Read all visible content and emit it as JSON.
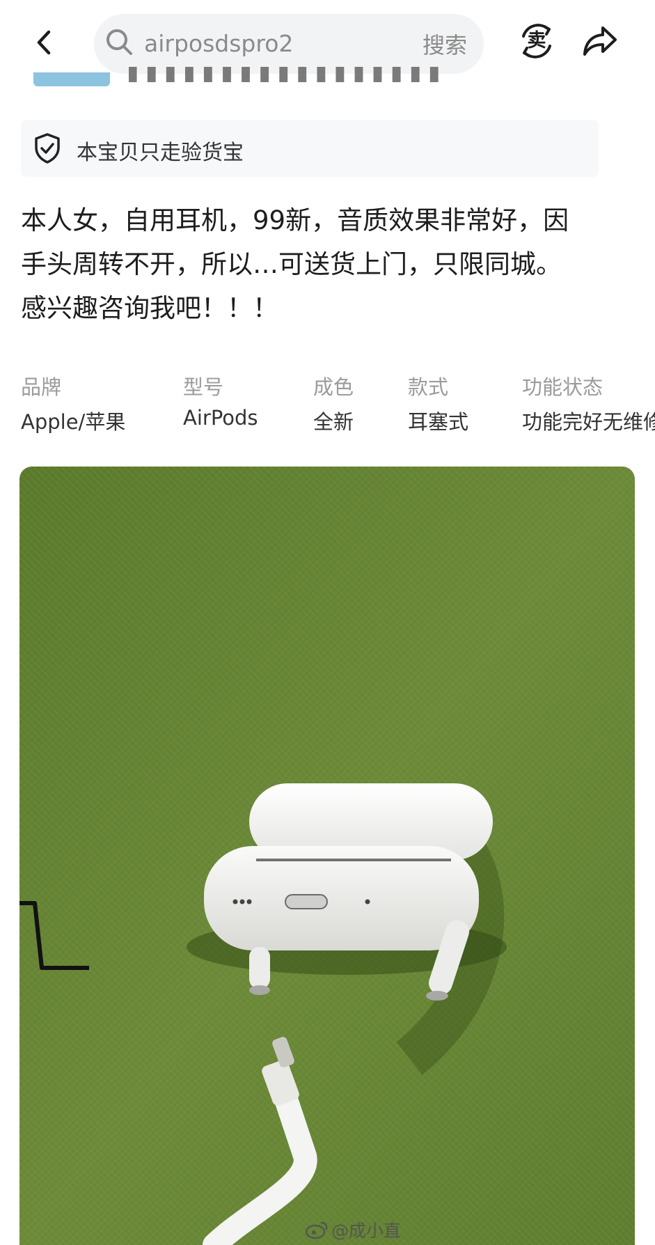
{
  "header": {
    "search": {
      "value": "airposdspro2",
      "button_label": "搜索"
    },
    "sell_label": "卖"
  },
  "guarantee": {
    "text": "本宝贝只走验货宝"
  },
  "description": {
    "lines": [
      "本人女，自用耳机，99新，音质效果非常好，因",
      "手头周转不开，所以…可送货上门，只限同城。",
      "感兴趣咨询我吧！！！"
    ]
  },
  "specs": [
    {
      "label": "品牌",
      "value": "Apple/苹果"
    },
    {
      "label": "型号",
      "value": "AirPods"
    },
    {
      "label": "成色",
      "value": "全新"
    },
    {
      "label": "款式",
      "value": "耳塞式"
    },
    {
      "label": "功能状态",
      "value": "功能完好无维修"
    }
  ],
  "watermark": {
    "text": "@成小直"
  },
  "colors": {
    "background_green": "#6d8b3a",
    "case_white": "#f4f4f2",
    "banner_blue": "#8cc4e0"
  },
  "icons": {
    "back": "chevron-left-icon",
    "search": "search-icon",
    "sell": "sell-icon",
    "share": "share-icon",
    "guarantee": "shield-check-icon"
  }
}
